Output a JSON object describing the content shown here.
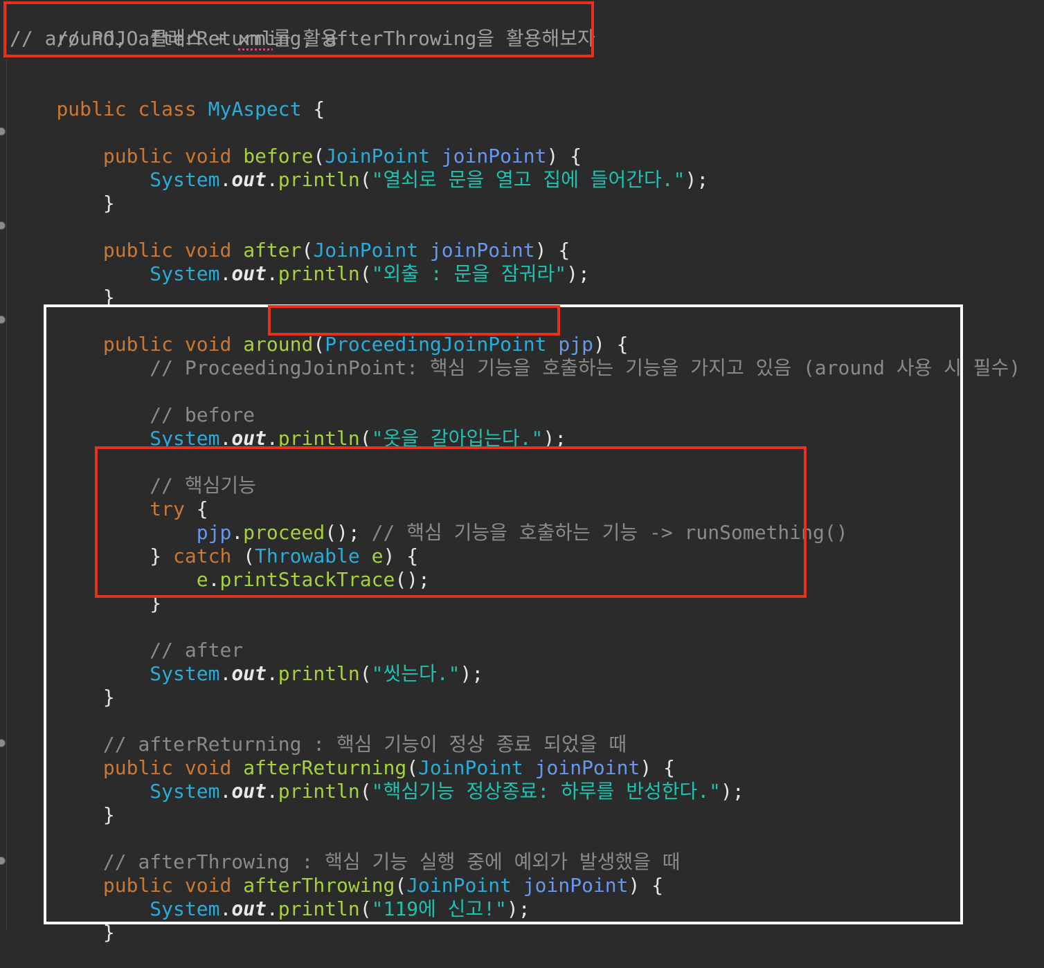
{
  "top_comment": {
    "l1": {
      "slashes": "// ",
      "text_a": "POJO 클래스 + ",
      "xml": "xml",
      "text_b": "를 활용"
    },
    "l2": "// around, afterReturning, afterThrowing을 활용해보자"
  },
  "kw": {
    "public": "public",
    "class": "class",
    "void": "void",
    "try": "try",
    "catch": "catch"
  },
  "class_name": "MyAspect",
  "types": {
    "jp": "JoinPoint",
    "pjp": "ProceedingJoinPoint",
    "throwable": "Throwable",
    "system": "System"
  },
  "params": {
    "jp": "joinPoint",
    "pjp": "pjp",
    "e": "e"
  },
  "methods": {
    "before": "before",
    "after": "after",
    "around": "around",
    "afterReturning": "afterReturning",
    "afterThrowing": "afterThrowing",
    "println": "println",
    "proceed": "proceed",
    "printStackTrace": "printStackTrace"
  },
  "out": "out",
  "strings": {
    "before": "\"열쇠로 문을 열고 집에 들어간다.\"",
    "after": "\"외출 : 문을 잠궈라\"",
    "around_before": "\"옷을 갈아입는다.\"",
    "around_after": "\"씻는다.\"",
    "afterReturning": "\"핵심기능 정상종료: 하루를 반성한다.\"",
    "afterThrowing": "\"119에 신고!\""
  },
  "comments": {
    "pjp": "// ProceedingJoinPoint: 핵심 기능을 호출하는 기능을 가지고 있음 (around 사용 시 필수)",
    "before": "// before",
    "core": "// 핵심기능",
    "proceed": "// 핵심 기능을 호출하는 기능 -> runSomething()",
    "after": "// after",
    "afterReturning": "// afterReturning : 핵심 기능이 정상 종료 되었을 때",
    "afterThrowing": "// afterThrowing : 핵심 기능 실행 중에 예외가 발생했을 때"
  },
  "punct": {
    "open_brace": "{",
    "close_brace": "}",
    "lparen": "(",
    "rparen": ")",
    "dot": ".",
    "semi": ";",
    "call_end": "();",
    "close_catch": "} ",
    "sp": " ",
    "sp4": "    ",
    "sp8": "        ",
    "sp12": "            "
  },
  "colors": {
    "background": "#2b2b2b",
    "keyword": "#cc7832",
    "type": "#2aacd9",
    "parameter": "#6897f0",
    "method": "#a6d23c",
    "string": "#1fc1b0",
    "comment": "#8a8a8a",
    "highlight_red": "#e8311a",
    "highlight_white": "#ffffff"
  }
}
